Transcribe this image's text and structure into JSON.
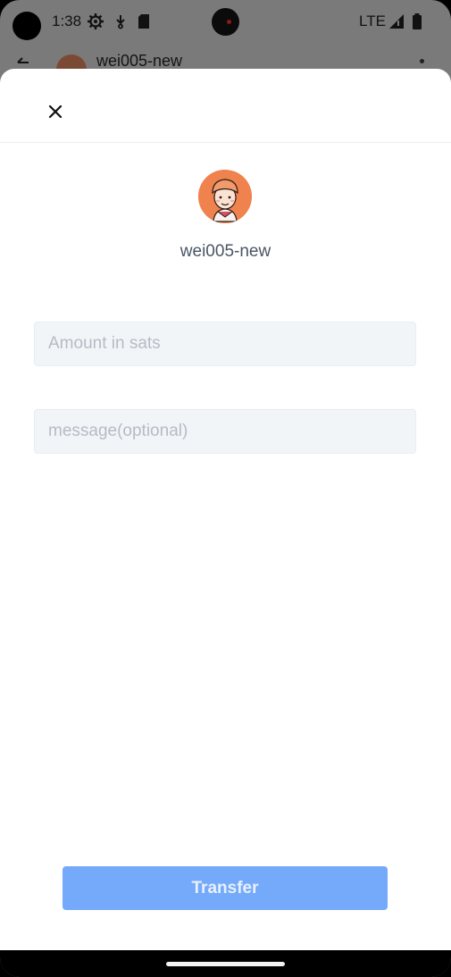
{
  "status_bar": {
    "time": "1:38",
    "carrier": "LTE",
    "icons": [
      "settings-gear-icon",
      "download-icon",
      "sd-card-icon",
      "signal-icon",
      "battery-icon"
    ]
  },
  "app_header": {
    "contact_name": "wei005-new",
    "icons": [
      "back-arrow-icon",
      "more-options-icon"
    ]
  },
  "transfer_sheet": {
    "close_icon": "close-icon",
    "recipient": {
      "name": "wei005-new",
      "avatar": "cartoon-avatar",
      "avatar_color": "#f0824d"
    },
    "amount_input": {
      "value": "",
      "placeholder": "Amount in sats"
    },
    "message_input": {
      "value": "",
      "placeholder": "message(optional)"
    },
    "transfer_button": {
      "label": "Transfer",
      "color": "#74aaf9",
      "state": "disabled"
    }
  }
}
